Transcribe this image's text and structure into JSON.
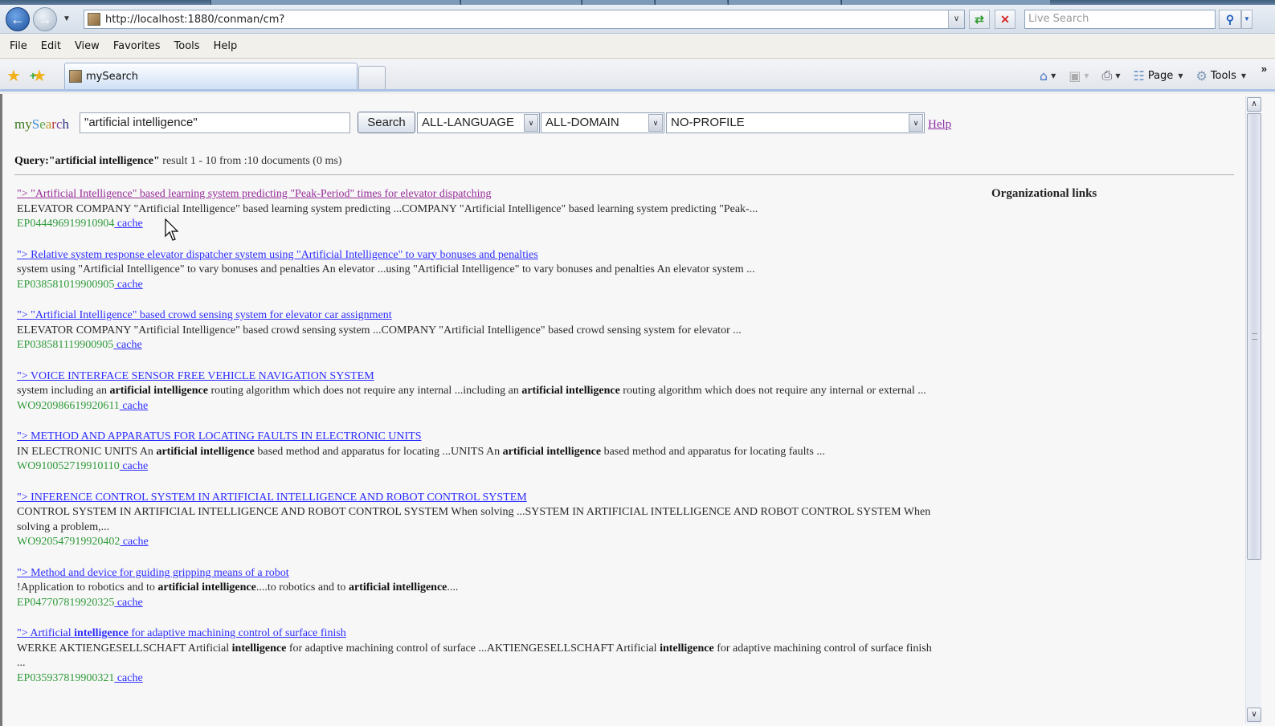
{
  "browser": {
    "url": "http://localhost:1880/conman/cm?",
    "live_search_placeholder": "Live Search",
    "menu": [
      "File",
      "Edit",
      "View",
      "Favorites",
      "Tools",
      "Help"
    ],
    "tab_title": "mySearch",
    "command_bar": {
      "page_label": "Page",
      "tools_label": "Tools"
    },
    "icons": {
      "back": "back-arrow-icon",
      "forward": "forward-arrow-icon",
      "refresh": "refresh-icon",
      "stop": "stop-icon",
      "search": "search-magnifier-icon",
      "favorites": "star-icon",
      "add_favorite": "add-star-icon",
      "home": "home-icon",
      "feeds": "rss-icon",
      "print": "printer-icon",
      "page": "page-icon",
      "tools": "gear-icon"
    }
  },
  "page": {
    "logo": {
      "letters": [
        {
          "ch": "m",
          "color": "#3d7a23"
        },
        {
          "ch": "y",
          "color": "#4a7d1e"
        },
        {
          "ch": "S",
          "color": "#3f8fd0"
        },
        {
          "ch": "e",
          "color": "#5aa347"
        },
        {
          "ch": "a",
          "color": "#c09a2a"
        },
        {
          "ch": "r",
          "color": "#b23a3a"
        },
        {
          "ch": "c",
          "color": "#7a3e9a"
        },
        {
          "ch": "h",
          "color": "#2a2f7a"
        }
      ]
    },
    "search": {
      "query_value": "\"artificial intelligence\"",
      "button_label": "Search",
      "language": "ALL-LANGUAGE",
      "domain": "ALL-DOMAIN",
      "profile": "NO-PROFILE",
      "help_label": "Help"
    },
    "summary": {
      "label": "Query:",
      "query": "\"artificial intelligence\"",
      "rest": " result 1 - 10 from :10 documents (0 ms)"
    },
    "sidebar_title": "Organizational links",
    "results": [
      {
        "visited": true,
        "title": [
          {
            "t": "\"> \"Artificial Intelligence\" based learning system predicting \"Peak-Period\" times for elevator dispatching",
            "b": false
          }
        ],
        "snippet": [
          {
            "t": "ELEVATOR COMPANY \"Artificial Intelligence\" based learning system predicting ...COMPANY \"Artificial Intelligence\" based learning system predicting \"Peak-...",
            "b": false
          }
        ],
        "id": "EP044496919910904",
        "cache_label": " cache"
      },
      {
        "visited": false,
        "title": [
          {
            "t": "\"> Relative system response elevator dispatcher system using \"Artificial Intelligence\" to vary bonuses and penalties",
            "b": false
          }
        ],
        "snippet": [
          {
            "t": "system using \"Artificial Intelligence\" to vary bonuses and penalties An elevator ...using \"Artificial Intelligence\" to vary bonuses and penalties An elevator system ...",
            "b": false
          }
        ],
        "id": "EP038581019900905",
        "cache_label": " cache"
      },
      {
        "visited": false,
        "title": [
          {
            "t": "\"> \"Artificial Intelligence\" based crowd sensing system for elevator car assignment",
            "b": false
          }
        ],
        "snippet": [
          {
            "t": "ELEVATOR COMPANY \"Artificial Intelligence\" based crowd sensing system ...COMPANY \"Artificial Intelligence\" based crowd sensing system for elevator ...",
            "b": false
          }
        ],
        "id": "EP038581119900905",
        "cache_label": " cache"
      },
      {
        "visited": false,
        "title": [
          {
            "t": "\"> VOICE INTERFACE SENSOR FREE VEHICLE NAVIGATION SYSTEM",
            "b": false
          }
        ],
        "snippet": [
          {
            "t": "system including an ",
            "b": false
          },
          {
            "t": "artificial intelligence",
            "b": true
          },
          {
            "t": " routing algorithm which does not require any internal ...including an ",
            "b": false
          },
          {
            "t": "artificial intelligence",
            "b": true
          },
          {
            "t": " routing algorithm which does not require any internal or external ...",
            "b": false
          }
        ],
        "id": "WO920986619920611",
        "cache_label": " cache"
      },
      {
        "visited": false,
        "title": [
          {
            "t": "\"> METHOD AND APPARATUS FOR LOCATING FAULTS IN ELECTRONIC UNITS",
            "b": false
          }
        ],
        "snippet": [
          {
            "t": "IN ELECTRONIC UNITS An ",
            "b": false
          },
          {
            "t": "artificial intelligence",
            "b": true
          },
          {
            "t": " based method and apparatus for locating ...UNITS An ",
            "b": false
          },
          {
            "t": "artificial intelligence",
            "b": true
          },
          {
            "t": " based method and apparatus for locating faults ...",
            "b": false
          }
        ],
        "id": "WO910052719910110",
        "cache_label": " cache"
      },
      {
        "visited": false,
        "title": [
          {
            "t": "\"> INFERENCE CONTROL SYSTEM IN ARTIFICIAL INTELLIGENCE AND ROBOT CONTROL SYSTEM",
            "b": false
          }
        ],
        "snippet": [
          {
            "t": "CONTROL SYSTEM IN ARTIFICIAL INTELLIGENCE AND ROBOT CONTROL SYSTEM When solving ...SYSTEM IN ARTIFICIAL INTELLIGENCE AND ROBOT CONTROL SYSTEM When solving a problem,...",
            "b": false
          }
        ],
        "id": "WO920547919920402",
        "cache_label": " cache"
      },
      {
        "visited": false,
        "title": [
          {
            "t": "\"> Method and device for guiding gripping means of a robot",
            "b": false
          }
        ],
        "snippet": [
          {
            "t": "!Application to robotics and to ",
            "b": false
          },
          {
            "t": "artificial intelligence",
            "b": true
          },
          {
            "t": "....to robotics and to ",
            "b": false
          },
          {
            "t": "artificial intelligence",
            "b": true
          },
          {
            "t": "....",
            "b": false
          }
        ],
        "id": "EP047707819920325",
        "cache_label": " cache"
      },
      {
        "visited": false,
        "title": [
          {
            "t": "\"> Artificial ",
            "b": false
          },
          {
            "t": "intelligence",
            "b": true
          },
          {
            "t": " for adaptive machining control of surface finish",
            "b": false
          }
        ],
        "snippet": [
          {
            "t": "WERKE AKTIENGESELLSCHAFT Artificial ",
            "b": false
          },
          {
            "t": "intelligence",
            "b": true
          },
          {
            "t": " for adaptive machining control of surface ...AKTIENGESELLSCHAFT Artificial ",
            "b": false
          },
          {
            "t": "intelligence",
            "b": true
          },
          {
            "t": " for adaptive machining control of surface finish ...",
            "b": false
          }
        ],
        "id": "EP035937819900321",
        "cache_label": " cache"
      }
    ]
  }
}
